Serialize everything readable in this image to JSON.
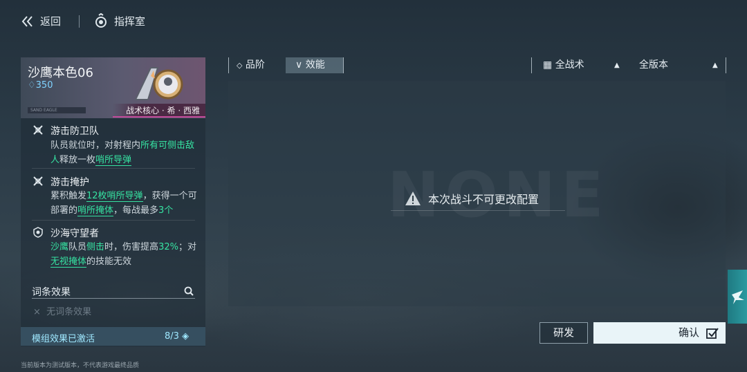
{
  "header": {
    "back_label": "返回",
    "room_label": "指挥室"
  },
  "card": {
    "name": "沙鹰本色06",
    "cost": "350",
    "plate_text": "SAND EAGLE",
    "tag": "战术核心 · 希 · 西雅"
  },
  "skills": [
    {
      "title": "游击防卫队",
      "desc_parts": [
        "队员就位时，对射程内",
        "所有可侧击敌人",
        "释放一枚",
        "哨所导弹"
      ]
    },
    {
      "title": "游击掩护",
      "desc_parts": [
        "累积触发",
        "12枚哨所导弹",
        "，获得一个可部署的",
        "哨所掩体",
        "，每战最多",
        "3个"
      ]
    },
    {
      "title": "沙海守望者",
      "desc_parts": [
        "沙鹰",
        "队员",
        "侧击",
        "时，伤害提高",
        "32%",
        "；对",
        "无视掩体",
        "的技能无效"
      ]
    }
  ],
  "modifiers": {
    "title": "词条效果",
    "empty_text": "无词条效果"
  },
  "module": {
    "label": "模组效果已激活",
    "count": "8/3"
  },
  "footnote": "当前版本为测试版本，不代表游戏最终品质",
  "filters": {
    "rank_label": "品阶",
    "effect_label": "效能",
    "tactic_label": "全战术",
    "version_label": "全版本"
  },
  "main": {
    "notice": "本次战斗不可更改配置",
    "watermark": "NONE"
  },
  "buttons": {
    "develop": "研发",
    "confirm": "确认"
  },
  "colors": {
    "highlight": "#36e3a2",
    "accent_cyan": "#7fd3ff",
    "tag_border": "#c04a9a"
  }
}
